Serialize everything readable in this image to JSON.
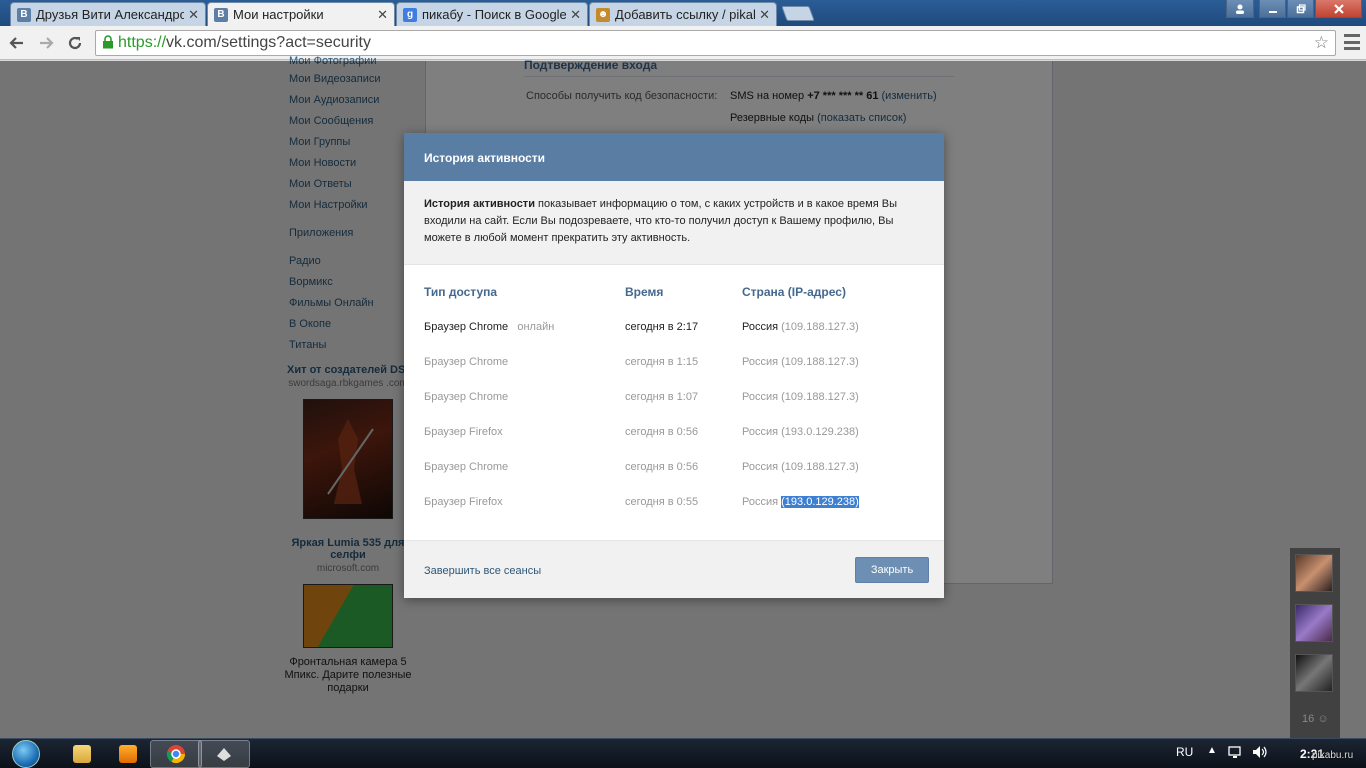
{
  "browser": {
    "tabs": [
      {
        "title": "Друзья Вити Александро",
        "favicon": "В",
        "favicon_color": "#5b7fa6",
        "close": "✕"
      },
      {
        "title": "Мои настройки",
        "favicon": "В",
        "favicon_color": "#5b7fa6",
        "close": "✕"
      },
      {
        "title": "пикабу - Поиск в Google",
        "favicon": "g",
        "favicon_color": "#3f7de0",
        "close": "✕"
      },
      {
        "title": "Добавить ссылку / pikab",
        "favicon": "☻",
        "favicon_color": "#c58a2b",
        "close": "✕"
      }
    ],
    "url_scheme": "https://",
    "url_rest": "vk.com/settings?act=security"
  },
  "sidebar": {
    "items": [
      "Мои Фотографии",
      "Мои Видеозаписи",
      "Мои Аудиозаписи",
      "Мои Сообщения",
      "Мои Группы",
      "Мои Новости",
      "Мои Ответы",
      "Мои Настройки"
    ],
    "apps_header": "Приложения",
    "apps": [
      "Радио",
      "Вормикс",
      "Фильмы Онлайн",
      "В Окопе",
      "Титаны"
    ],
    "ad1": {
      "title": "Хит от создателей DS!",
      "domain": "swordsaga.rbkgames .com"
    },
    "ad2": {
      "title": "Яркая Lumia 535 для селфи",
      "domain": "microsoft.com",
      "text": "Фронтальная камера 5 Мпикс. Дарите полезные подарки"
    }
  },
  "settings": {
    "section_title": "Подтверждение входа",
    "methods_label": "Способы получить код безопасности:",
    "sms_prefix": "SMS на номер ",
    "sms_number": "+7 *** *** ** 61",
    "sms_change": "(изменить)",
    "backup_codes": "Резервные коды ",
    "backup_show": "(показать список)"
  },
  "modal": {
    "title": "История активности",
    "info_bold": "История активности",
    "info_text": " показывает информацию о том, с каких устройств и в какое время Вы входили на сайт. Если Вы подозреваете, что кто-то получил доступ к Вашему профилю, Вы можете в любой момент прекратить эту активность.",
    "columns": [
      "Тип доступа",
      "Время",
      "Страна (IP-адрес)"
    ],
    "rows": [
      {
        "type": "Браузер Chrome",
        "status": "онлайн",
        "time": "сегодня в 2:17",
        "country": "Россия",
        "ip": "(109.188.127.3)"
      },
      {
        "type": "Браузер Chrome",
        "status": "",
        "time": "сегодня в 1:15",
        "country": "Россия",
        "ip": "(109.188.127.3)"
      },
      {
        "type": "Браузер Chrome",
        "status": "",
        "time": "сегодня в 1:07",
        "country": "Россия",
        "ip": "(109.188.127.3)"
      },
      {
        "type": "Браузер Firefox",
        "status": "",
        "time": "сегодня в 0:56",
        "country": "Россия",
        "ip": "(193.0.129.238)"
      },
      {
        "type": "Браузер Chrome",
        "status": "",
        "time": "сегодня в 0:56",
        "country": "Россия",
        "ip": "(109.188.127.3)"
      },
      {
        "type": "Браузер Firefox",
        "status": "",
        "time": "сегодня в 0:55",
        "country": "Россия",
        "ip": "(193.0.129.238)"
      }
    ],
    "end_sessions": "Завершить все сеансы",
    "close": "Закрыть"
  },
  "chat": {
    "count": "16"
  },
  "taskbar": {
    "lang": "RU",
    "clock": "2:21"
  },
  "watermark": "pikabu.ru",
  "colors": {
    "vk_header": "#597da3",
    "link": "#2b587a",
    "button": "#6d8fb3",
    "selection": "#3d7fd1"
  }
}
